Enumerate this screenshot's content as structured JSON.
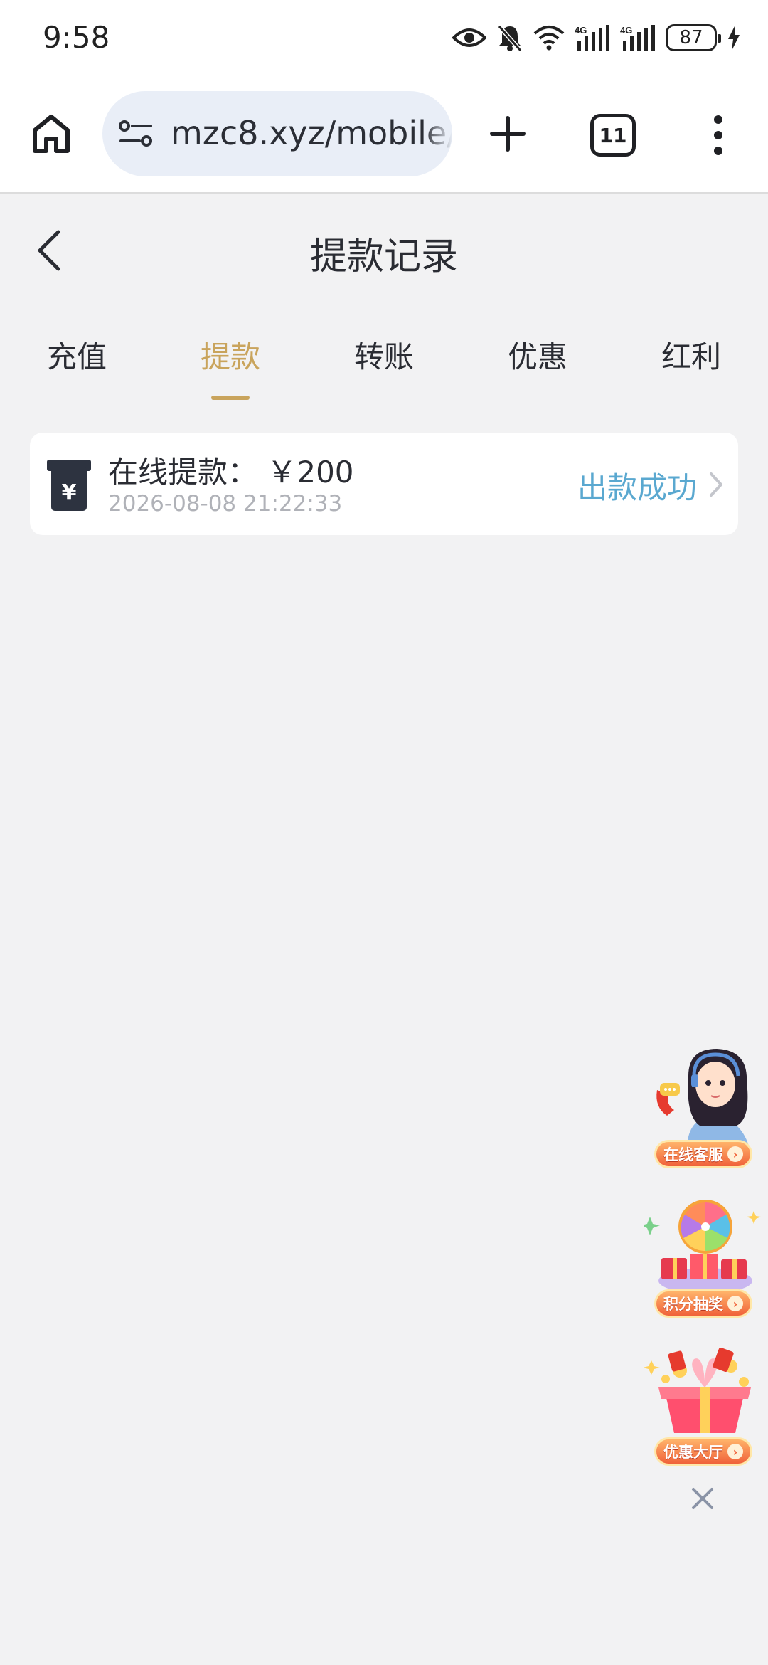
{
  "status_bar": {
    "time": "9:58",
    "battery": "87",
    "icons": [
      "eye-icon",
      "bell-muted-icon",
      "wifi-icon",
      "signal-4g-icon",
      "signal-4g-icon",
      "battery-icon",
      "charging-icon"
    ]
  },
  "browser": {
    "url": "mzc8.xyz/mobile/",
    "tab_count": "11"
  },
  "page": {
    "title": "提款记录"
  },
  "tabs": [
    {
      "label": "充值",
      "active": false
    },
    {
      "label": "提款",
      "active": true
    },
    {
      "label": "转账",
      "active": false
    },
    {
      "label": "优惠",
      "active": false
    },
    {
      "label": "红利",
      "active": false
    }
  ],
  "records": [
    {
      "title": "在线提款： ￥200",
      "time": "2026-08-08 21:22:33",
      "status": "出款成功"
    }
  ],
  "floating": {
    "customer_service": "在线客服",
    "lottery": "积分抽奖",
    "promotions": "优惠大厅"
  },
  "colors": {
    "accent": "#c9a45c",
    "status_success": "#5aa8d0",
    "background": "#f2f2f3"
  }
}
